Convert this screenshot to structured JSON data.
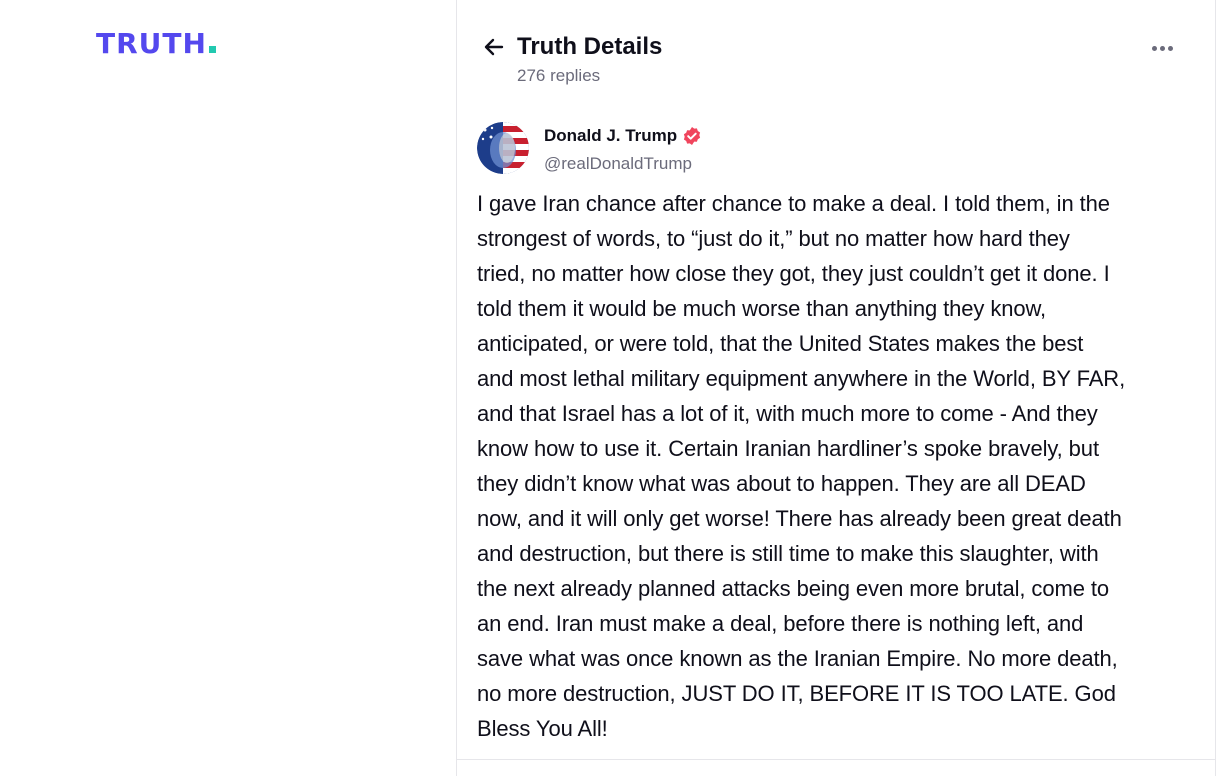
{
  "brand": {
    "logo_text": "TRUTH",
    "logo_color": "#5448ee",
    "dot_color": "#22c9b0"
  },
  "header": {
    "back_icon": "arrow-left-icon",
    "title": "Truth Details",
    "replies": "276 replies",
    "more_icon": "more-horizontal-icon"
  },
  "post": {
    "author_name": "Donald J. Trump",
    "verified_icon": "verified-badge-icon",
    "verified_color": "#f0455d",
    "handle": "@realDonaldTrump",
    "body": "I gave Iran chance after chance to make a deal. I told them, in the\nstrongest of words, to “just do it,” but no matter how hard they\ntried, no matter how close they got, they just couldn’t get it done. I\ntold them it would be much worse than anything they know,\nanticipated, or were told, that the United States makes the best\nand most lethal military equipment anywhere in the World, BY FAR,\nand that Israel has a lot of it, with much more to come - And they\nknow how to use it. Certain Iranian hardliner’s spoke bravely, but\nthey didn’t know what was about to happen. They are all DEAD\nnow, and it will only get worse! There has already been great death\nand destruction, but there is still time to make this slaughter, with\nthe next already planned attacks being even more brutal, come to\nan end. Iran must make a deal, before there is nothing left, and\nsave what was once known as the Iranian Empire. No more death,\nno more destruction, JUST DO IT, BEFORE IT IS TOO LATE. God\nBless You All!"
  }
}
